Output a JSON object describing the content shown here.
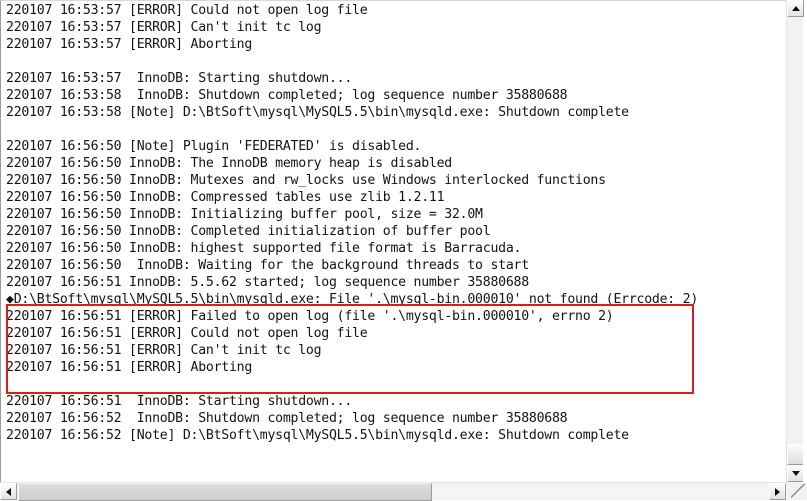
{
  "window": {
    "type": "text-editor-log-viewer",
    "background_color": "#ffffff",
    "text_color": "#141414"
  },
  "annotation": {
    "shape": "rectangle",
    "color": "#e01b1b",
    "highlights_lines": [
      19,
      20,
      21,
      22
    ]
  },
  "log": {
    "lines": [
      "220107 16:53:57 [ERROR] Could not open log file",
      "220107 16:53:57 [ERROR] Can't init tc log",
      "220107 16:53:57 [ERROR] Aborting",
      "",
      "220107 16:53:57  InnoDB: Starting shutdown...",
      "220107 16:53:58  InnoDB: Shutdown completed; log sequence number 35880688",
      "220107 16:53:58 [Note] D:\\BtSoft\\mysql\\MySQL5.5\\bin\\mysqld.exe: Shutdown complete",
      "",
      "220107 16:56:50 [Note] Plugin 'FEDERATED' is disabled.",
      "220107 16:56:50 InnoDB: The InnoDB memory heap is disabled",
      "220107 16:56:50 InnoDB: Mutexes and rw_locks use Windows interlocked functions",
      "220107 16:56:50 InnoDB: Compressed tables use zlib 1.2.11",
      "220107 16:56:50 InnoDB: Initializing buffer pool, size = 32.0M",
      "220107 16:56:50 InnoDB: Completed initialization of buffer pool",
      "220107 16:56:50 InnoDB: highest supported file format is Barracuda.",
      "220107 16:56:50  InnoDB: Waiting for the background threads to start",
      "220107 16:56:51 InnoDB: 5.5.62 started; log sequence number 35880688",
      "◆D:\\BtSoft\\mysql\\MySQL5.5\\bin\\mysqld.exe: File '.\\mysql-bin.000010' not found (Errcode: 2)",
      "220107 16:56:51 [ERROR] Failed to open log (file '.\\mysql-bin.000010', errno 2)",
      "220107 16:56:51 [ERROR] Could not open log file",
      "220107 16:56:51 [ERROR] Can't init tc log",
      "220107 16:56:51 [ERROR] Aborting",
      "",
      "220107 16:56:51  InnoDB: Starting shutdown...",
      "220107 16:56:52  InnoDB: Shutdown completed; log sequence number 35880688",
      "220107 16:56:52 [Note] D:\\BtSoft\\mysql\\MySQL5.5\\bin\\mysqld.exe: Shutdown complete"
    ]
  },
  "scrollbars": {
    "vertical": {
      "up_arrow": "▲",
      "down_arrow": "▼",
      "thumb_position_percent": 96
    },
    "horizontal": {
      "left_arrow": "◀",
      "right_arrow": "▶",
      "thumb_position_percent": 0,
      "thumb_width_percent": 55
    }
  }
}
